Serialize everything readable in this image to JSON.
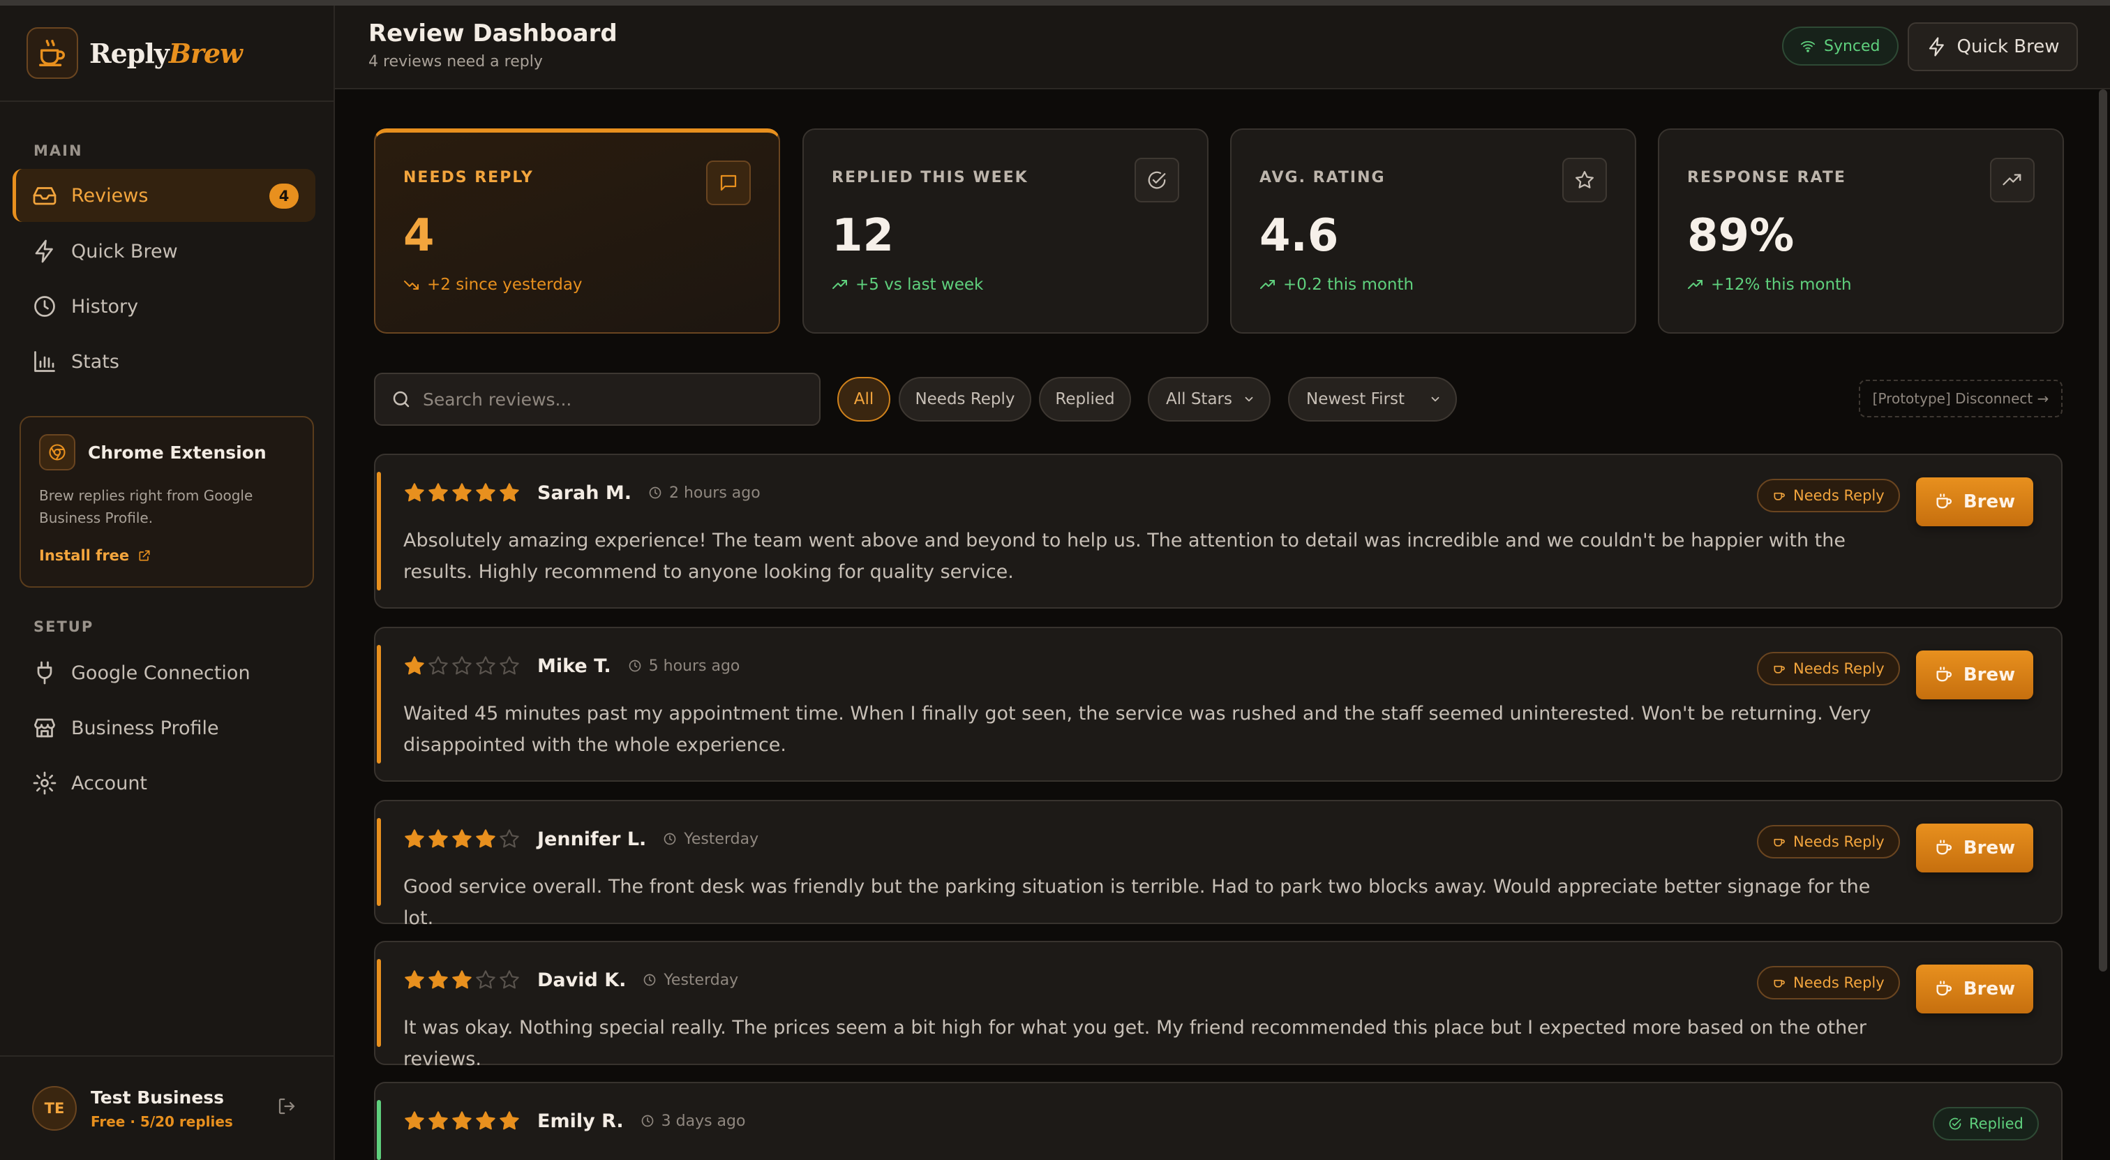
{
  "brand": {
    "name_a": "Reply",
    "name_b": "Brew"
  },
  "sidebar": {
    "main_label": "MAIN",
    "setup_label": "SETUP",
    "main_items": [
      {
        "label": "Reviews",
        "badge": "4"
      },
      {
        "label": "Quick Brew"
      },
      {
        "label": "History"
      },
      {
        "label": "Stats"
      }
    ],
    "setup_items": [
      {
        "label": "Google Connection"
      },
      {
        "label": "Business Profile"
      },
      {
        "label": "Account"
      }
    ],
    "extension": {
      "title": "Chrome Extension",
      "desc": "Brew replies right from Google Business Profile.",
      "link": "Install free"
    },
    "user": {
      "initials": "TE",
      "name": "Test Business",
      "plan": "Free · 5/20 replies"
    }
  },
  "header": {
    "title": "Review Dashboard",
    "subtitle": "4 reviews need a reply",
    "synced": "Synced",
    "quick_brew": "Quick Brew"
  },
  "stats": [
    {
      "label": "NEEDS REPLY",
      "value": "4",
      "delta": "+2 since yesterday"
    },
    {
      "label": "REPLIED THIS WEEK",
      "value": "12",
      "delta": "+5 vs last week"
    },
    {
      "label": "AVG. RATING",
      "value": "4.6",
      "delta": "+0.2 this month"
    },
    {
      "label": "RESPONSE RATE",
      "value": "89%",
      "delta": "+12% this month"
    }
  ],
  "filters": {
    "search_placeholder": "Search reviews...",
    "chips": [
      "All",
      "Needs Reply",
      "Replied"
    ],
    "stars_select": "All Stars",
    "sort_select": "Newest First",
    "disconnect": "[Prototype] Disconnect →"
  },
  "colors": {
    "accent": "#e8901e",
    "success": "#5fd07d",
    "background": "#0d0b09",
    "panel": "#1d1a17"
  },
  "reviews": [
    {
      "rating": 5,
      "name": "Sarah M.",
      "time": "2 hours ago",
      "status": "Needs Reply",
      "action": "Brew",
      "text": "Absolutely amazing experience! The team went above and beyond to help us. The attention to detail was incredible and we couldn't be happier with the results. Highly recommend to anyone looking for quality service."
    },
    {
      "rating": 1,
      "name": "Mike T.",
      "time": "5 hours ago",
      "status": "Needs Reply",
      "action": "Brew",
      "text": "Waited 45 minutes past my appointment time. When I finally got seen, the service was rushed and the staff seemed uninterested. Won't be returning. Very disappointed with the whole experience."
    },
    {
      "rating": 4,
      "name": "Jennifer L.",
      "time": "Yesterday",
      "status": "Needs Reply",
      "action": "Brew",
      "text": "Good service overall. The front desk was friendly but the parking situation is terrible. Had to park two blocks away. Would appreciate better signage for the lot."
    },
    {
      "rating": 3,
      "name": "David K.",
      "time": "Yesterday",
      "status": "Needs Reply",
      "action": "Brew",
      "text": "It was okay. Nothing special really. The prices seem a bit high for what you get. My friend recommended this place but I expected more based on the other reviews."
    },
    {
      "rating": 5,
      "name": "Emily R.",
      "time": "3 days ago",
      "status": "Replied",
      "text": ""
    }
  ]
}
